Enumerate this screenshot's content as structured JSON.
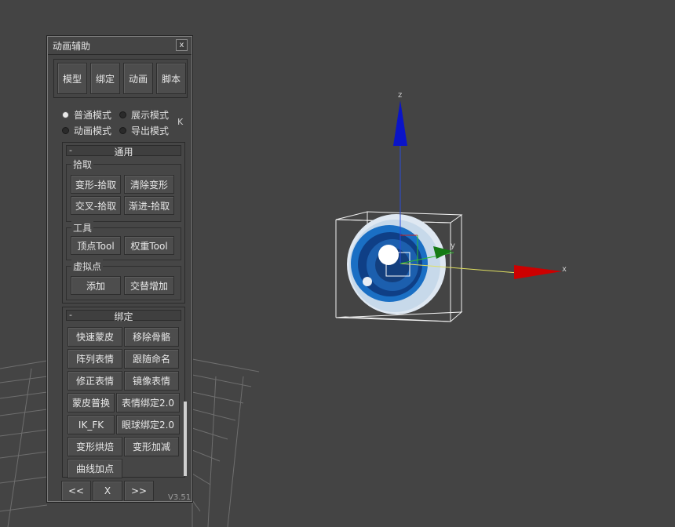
{
  "window": {
    "title": "动画辅助",
    "close": "x"
  },
  "top_tabs": [
    "模型",
    "绑定",
    "动画",
    "脚本"
  ],
  "modes": [
    {
      "label": "普通模式",
      "selected": true
    },
    {
      "label": "展示模式",
      "selected": false
    },
    {
      "label": "动画模式",
      "selected": false
    },
    {
      "label": "导出模式",
      "selected": false
    }
  ],
  "k_label": "K",
  "rollout_general": {
    "toggle": "-",
    "title": "通用",
    "pick": {
      "label": "拾取",
      "buttons": [
        "变形-拾取",
        "清除变形",
        "交叉-拾取",
        "渐进-拾取"
      ]
    },
    "tools": {
      "label": "工具",
      "buttons": [
        "顶点Tool",
        "权重Tool"
      ]
    },
    "virtual": {
      "label": "虚拟点",
      "buttons": [
        "添加",
        "交替增加"
      ]
    }
  },
  "rollout_rig": {
    "toggle": "-",
    "title": "绑定",
    "buttons": [
      "快速蒙皮",
      "移除骨骼",
      "阵列表情",
      "跟随命名",
      "修正表情",
      "镜像表情",
      "蒙皮普换",
      "表情绑定2.0",
      "IK_FK",
      "眼球绑定2.0",
      "变形烘焙",
      "变形加减",
      "曲线加点"
    ]
  },
  "footer": {
    "prev": "<<",
    "close": "X",
    "next": ">>",
    "version": "V3.51"
  },
  "viewport": {
    "axis_z": "z",
    "axis_x": "x",
    "axis_y": "y",
    "colors": {
      "background": "#444444",
      "grid": "#6a6a6a",
      "z_axis": "#0000cc",
      "x_axis": "#cc0000",
      "y_axis": "#00aa00",
      "eye_iris": "#1a6fc4"
    }
  }
}
